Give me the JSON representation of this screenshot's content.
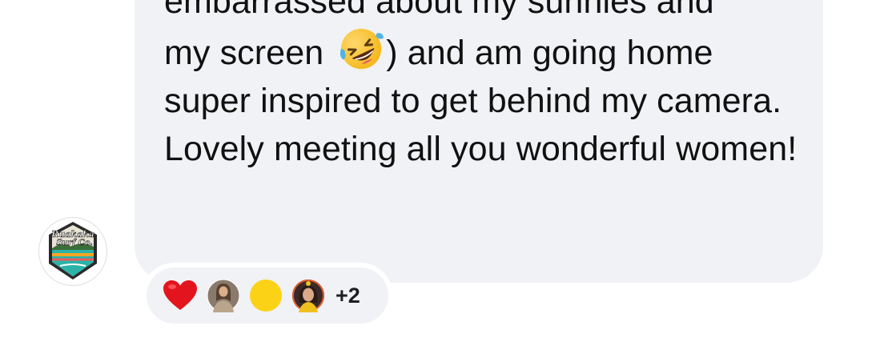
{
  "message": {
    "line_partial_top": "embarrassed about my sunnies and",
    "para1_before_emoji": "my screen ",
    "emoji_name": "rolling-on-the-floor-laughing",
    "para1_after_emoji": ") and am going home super inspired to get behind my camera.",
    "para2": "Lovely meeting all you wonderful women!"
  },
  "sender": {
    "avatar_icon": "ruakaka-surf-co-logo",
    "logo_text_line1": "Ruakaka",
    "logo_text_line2": "Surf Co."
  },
  "reactions": {
    "items": [
      "heart-reaction",
      "avatar-user-1",
      "yellow-dot",
      "avatar-user-2"
    ],
    "extra_count": "+2"
  },
  "colors": {
    "bubble": "#f1f2f5",
    "text": "#111111",
    "heart": "#e4141e",
    "yellow": "#fcd217"
  }
}
